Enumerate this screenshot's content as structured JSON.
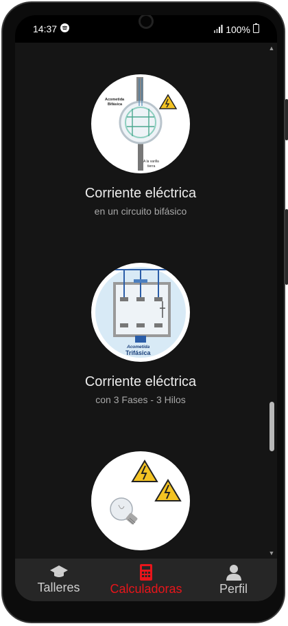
{
  "status_bar": {
    "time": "14:37",
    "battery": "100%",
    "icons": [
      "spotify-icon",
      "signal-icon",
      "battery-icon"
    ]
  },
  "cards": [
    {
      "title": "Corriente eléctrica",
      "subtitle": "en un circuito bifásico",
      "image_labels": {
        "top_left": "Acometida",
        "top_left2": "Bifásica",
        "bottom_right": "A la varilla",
        "bottom_right2": "tierra"
      }
    },
    {
      "title": "Corriente eléctrica",
      "subtitle": "con 3 Fases - 3 Hilos",
      "image_labels": {
        "bottom": "Acometida",
        "bottom2": "Trifásica"
      }
    },
    {
      "title": "",
      "subtitle": "",
      "image_labels": {}
    }
  ],
  "bottom_nav": {
    "items": [
      {
        "label": "Talleres",
        "icon": "graduation-cap-icon",
        "active": false
      },
      {
        "label": "Calculadoras",
        "icon": "calculator-icon",
        "active": true
      },
      {
        "label": "Perfil",
        "icon": "user-icon",
        "active": false
      }
    ]
  },
  "colors": {
    "accent": "#e8151b",
    "background": "#151515",
    "nav_background": "#262626"
  }
}
